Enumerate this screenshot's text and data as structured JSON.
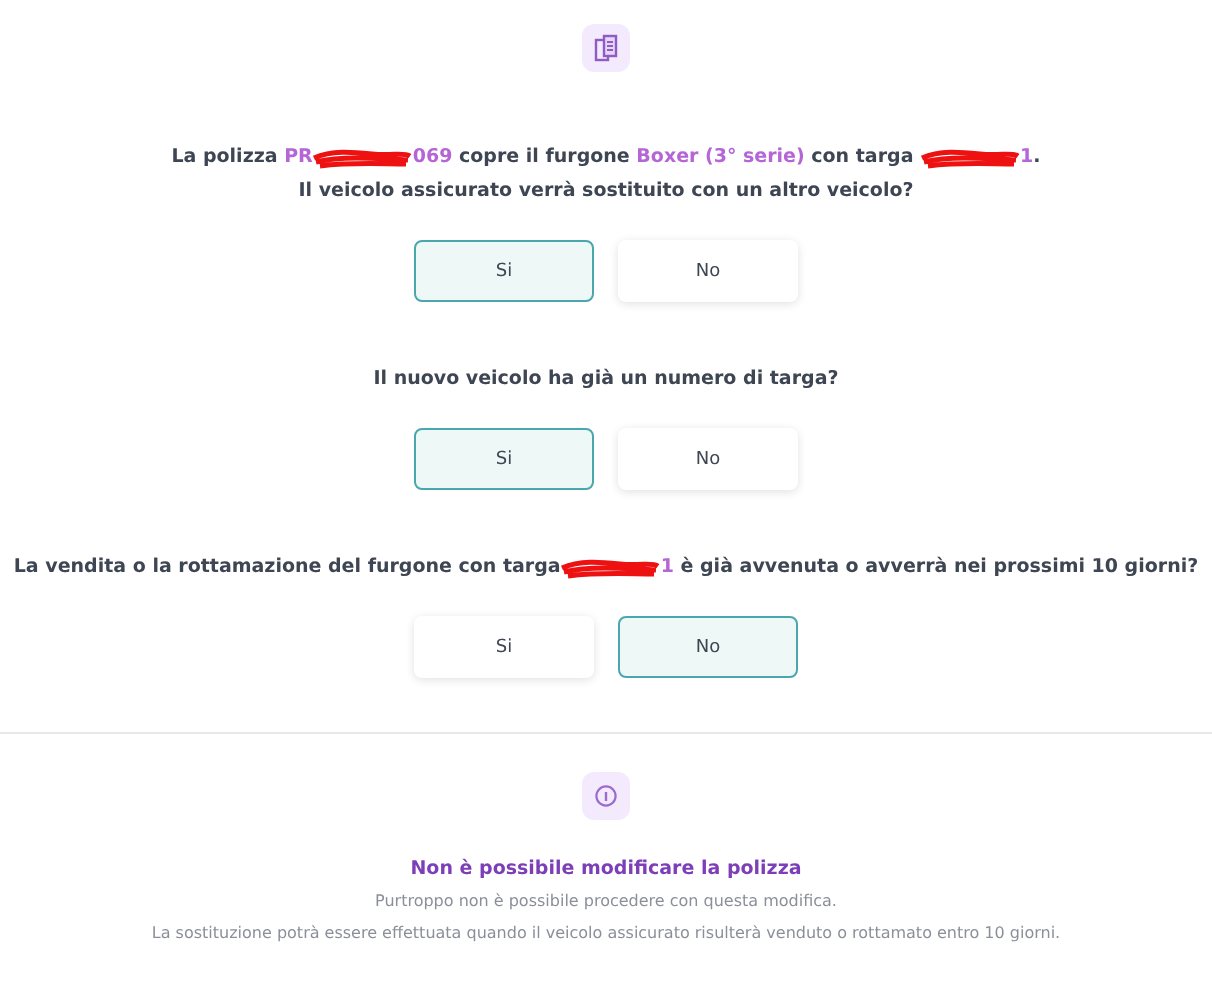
{
  "questions": [
    {
      "text": [
        {
          "kind": "text",
          "value": "La polizza "
        },
        {
          "kind": "highlight",
          "value": "PR"
        },
        {
          "kind": "redacted"
        },
        {
          "kind": "highlight",
          "value": "069"
        },
        {
          "kind": "text",
          "value": " copre il furgone "
        },
        {
          "kind": "highlight",
          "value": "Boxer (3° serie)"
        },
        {
          "kind": "text",
          "value": " con targa "
        },
        {
          "kind": "redacted"
        },
        {
          "kind": "highlight",
          "value": "1"
        },
        {
          "kind": "text",
          "value": "."
        },
        {
          "kind": "break"
        },
        {
          "kind": "text",
          "value": "Il veicolo assicurato verrà sostituito con un altro veicolo?"
        }
      ],
      "options": [
        {
          "label": "Si",
          "selected": true
        },
        {
          "label": "No",
          "selected": false
        }
      ]
    },
    {
      "text": [
        {
          "kind": "text",
          "value": "Il nuovo veicolo ha già un numero di targa?"
        }
      ],
      "options": [
        {
          "label": "Si",
          "selected": true
        },
        {
          "label": "No",
          "selected": false
        }
      ]
    },
    {
      "text": [
        {
          "kind": "text",
          "value": "La vendita o la rottamazione del furgone con targa"
        },
        {
          "kind": "redacted"
        },
        {
          "kind": "highlight",
          "value": "1"
        },
        {
          "kind": "text",
          "value": " è già avvenuta o avverrà nei prossimi 10 giorni?"
        }
      ],
      "options": [
        {
          "label": "Si",
          "selected": false
        },
        {
          "label": "No",
          "selected": true
        }
      ]
    }
  ],
  "notice": {
    "title": "Non è possibile modificare la polizza",
    "lines": [
      "Purtroppo non è possibile procedere con questa modifica.",
      "La sostituzione potrà essere effettuata quando il veicolo assicurato risulterà venduto o rottamato entro 10 giorni."
    ]
  }
}
